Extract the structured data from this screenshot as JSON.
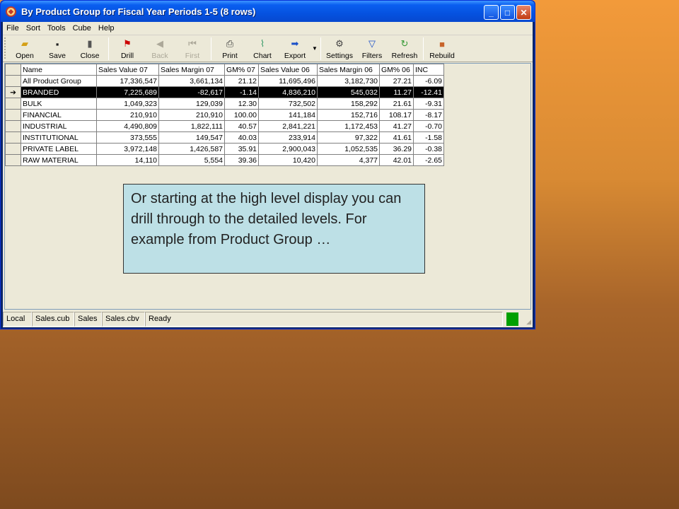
{
  "window": {
    "title": "By Product Group for Fiscal Year Periods 1-5  (8 rows)",
    "minimize": "_",
    "maximize": "□",
    "close": "✕"
  },
  "menu": [
    "File",
    "Sort",
    "Tools",
    "Cube",
    "Help"
  ],
  "toolbar": {
    "open": "Open",
    "save": "Save",
    "close": "Close",
    "drill": "Drill",
    "back": "Back",
    "first": "First",
    "print": "Print",
    "chart": "Chart",
    "export": "Export",
    "settings": "Settings",
    "filters": "Filters",
    "refresh": "Refresh",
    "rebuild": "Rebuild"
  },
  "grid": {
    "columns": [
      "Name",
      "Sales Value 07",
      "Sales Margin 07",
      "GM% 07",
      "Sales Value 06",
      "Sales Margin 06",
      "GM% 06",
      "INC"
    ],
    "rows": [
      [
        "All Product Group",
        "17,336,547",
        "3,661,134",
        "21.12",
        "11,695,496",
        "3,182,730",
        "27.21",
        "-6.09"
      ],
      [
        "BRANDED",
        "7,225,689",
        "-82,617",
        "-1.14",
        "4,836,210",
        "545,032",
        "11.27",
        "-12.41"
      ],
      [
        "BULK",
        "1,049,323",
        "129,039",
        "12.30",
        "732,502",
        "158,292",
        "21.61",
        "-9.31"
      ],
      [
        "FINANCIAL",
        "210,910",
        "210,910",
        "100.00",
        "141,184",
        "152,716",
        "108.17",
        "-8.17"
      ],
      [
        "INDUSTRIAL",
        "4,490,809",
        "1,822,111",
        "40.57",
        "2,841,221",
        "1,172,453",
        "41.27",
        "-0.70"
      ],
      [
        "INSTITUTIONAL",
        "373,555",
        "149,547",
        "40.03",
        "233,914",
        "97,322",
        "41.61",
        "-1.58"
      ],
      [
        "PRIVATE LABEL",
        "3,972,148",
        "1,426,587",
        "35.91",
        "2,900,043",
        "1,052,535",
        "36.29",
        "-0.38"
      ],
      [
        "RAW MATERIAL",
        "14,110",
        "5,554",
        "39.36",
        "10,420",
        "4,377",
        "42.01",
        "-2.65"
      ]
    ],
    "selected_row": 1
  },
  "note": "Or starting at the high level display you can drill through to the detailed levels.  For example from Product Group …",
  "status": {
    "panels": [
      "Local",
      "Sales.cub",
      "Sales",
      "Sales.cbv",
      "Ready"
    ],
    "indicator_color": "#00a000"
  }
}
